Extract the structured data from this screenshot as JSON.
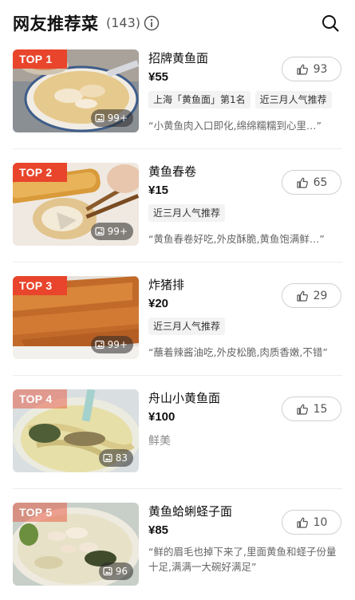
{
  "header": {
    "title": "网友推荐菜",
    "count": "(143)"
  },
  "items": [
    {
      "rank": "TOP 1",
      "photo_count": "99+",
      "name": "招牌黄鱼面",
      "price": "¥55",
      "tags": [
        "上海「黄鱼面」第1名",
        "近三月人气推荐"
      ],
      "quote": "“小黄鱼肉入口即化,绵绵糯糯到心里…”",
      "likes": "93"
    },
    {
      "rank": "TOP 2",
      "photo_count": "99+",
      "name": "黄鱼春卷",
      "price": "¥15",
      "tags": [
        "近三月人气推荐"
      ],
      "quote": "“黄鱼春卷好吃,外皮酥脆,黄鱼饱满鲜…”",
      "likes": "65"
    },
    {
      "rank": "TOP 3",
      "photo_count": "99+",
      "name": "炸猪排",
      "price": "¥20",
      "tags": [
        "近三月人气推荐"
      ],
      "quote": "“蘸着辣酱油吃,外皮松脆,肉质香嫩,不错”",
      "likes": "29"
    },
    {
      "rank": "TOP 4",
      "photo_count": "83",
      "name": "舟山小黄鱼面",
      "price": "¥100",
      "description": "鲜美",
      "likes": "15"
    },
    {
      "rank": "TOP 5",
      "photo_count": "96",
      "name": "黄鱼蛤蜊蛏子面",
      "price": "¥85",
      "quote": "“鲜的眉毛也掉下来了,里面黄鱼和蛏子份量十足,满满一大碗好满足”",
      "likes": "10"
    }
  ],
  "colors": {
    "rank_hot": "#e8452c",
    "text_primary": "#111111",
    "text_secondary": "#666666"
  },
  "icons": {
    "info": "info-icon",
    "search": "search-icon",
    "like": "thumbs-up-icon",
    "photo": "image-icon"
  }
}
